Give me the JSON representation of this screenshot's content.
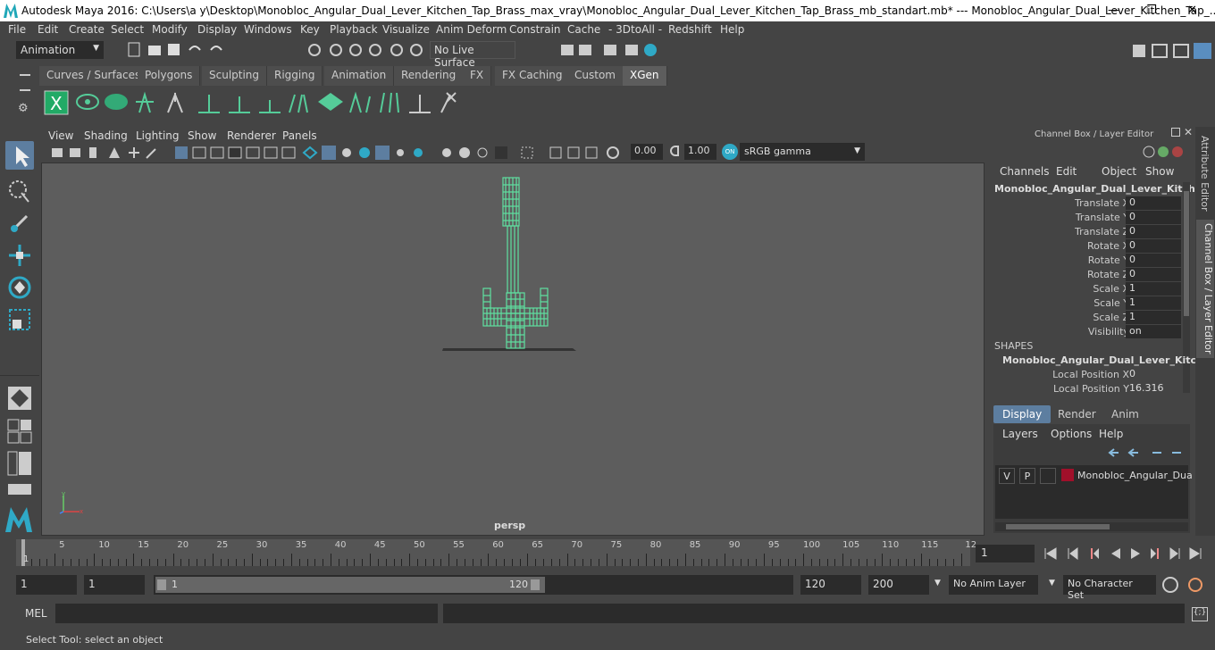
{
  "titlebar": {
    "title": "Autodesk Maya 2016: C:\\Users\\a y\\Desktop\\Monobloc_Angular_Dual_Lever_Kitchen_Tap_Brass_max_vray\\Monobloc_Angular_Dual_Lever_Kitchen_Tap_Brass_mb_standart.mb*  ---  Monobloc_Angular_Dual_Lever_Kitchen_Tap_...",
    "minimize": "—",
    "maximize": "❐",
    "close": "✕"
  },
  "menubar": [
    "File",
    "Edit",
    "Create",
    "Select",
    "Modify",
    "Display",
    "Windows",
    "Key",
    "Playback",
    "Visualize",
    "Anim Deform",
    "Constrain",
    "Cache",
    "- 3DtoAll -",
    "Redshift",
    "Help"
  ],
  "statusline": {
    "menuset": "Animation",
    "live_surface": "No Live Surface"
  },
  "shelf_tabs": [
    "Curves / Surfaces",
    "Polygons",
    "Sculpting",
    "Rigging",
    "Animation",
    "Rendering",
    "FX",
    "FX Caching",
    "Custom",
    "XGen"
  ],
  "active_shelf": "XGen",
  "viewport": {
    "menus": [
      "View",
      "Shading",
      "Lighting",
      "Show",
      "Renderer",
      "Panels"
    ],
    "exposure": "0.00",
    "gamma": "1.00",
    "colorspace": "sRGB gamma",
    "camera_label": "persp"
  },
  "channel_box": {
    "title": "Channel Box / Layer Editor",
    "menus": [
      "Channels",
      "Edit",
      "Object",
      "Show"
    ],
    "object_name": "Monobloc_Angular_Dual_Lever_Kitch...",
    "attributes": [
      {
        "label": "Translate X",
        "value": "0"
      },
      {
        "label": "Translate Y",
        "value": "0"
      },
      {
        "label": "Translate Z",
        "value": "0"
      },
      {
        "label": "Rotate X",
        "value": "0"
      },
      {
        "label": "Rotate Y",
        "value": "0"
      },
      {
        "label": "Rotate Z",
        "value": "0"
      },
      {
        "label": "Scale X",
        "value": "1"
      },
      {
        "label": "Scale Y",
        "value": "1"
      },
      {
        "label": "Scale Z",
        "value": "1"
      },
      {
        "label": "Visibility",
        "value": "on"
      }
    ],
    "shapes_header": "SHAPES",
    "shape_name": "Monobloc_Angular_Dual_Lever_Kitc...",
    "shape_attributes": [
      {
        "label": "Local Position X",
        "value": "0"
      },
      {
        "label": "Local Position Y",
        "value": "16.316"
      }
    ]
  },
  "layer_editor": {
    "tabs": [
      "Display",
      "Render",
      "Anim"
    ],
    "menus": [
      "Layers",
      "Options",
      "Help"
    ],
    "layer": {
      "v": "V",
      "p": "P",
      "name": "Monobloc_Angular_Dua",
      "color": "#a0102a"
    }
  },
  "side_tabs": [
    "Attribute Editor",
    "Channel Box / Layer Editor"
  ],
  "timeline": {
    "ticks": [
      "5",
      "10",
      "15",
      "20",
      "25",
      "30",
      "35",
      "40",
      "45",
      "50",
      "55",
      "60",
      "65",
      "70",
      "75",
      "80",
      "85",
      "90",
      "95",
      "100",
      "105",
      "110",
      "115",
      "12"
    ],
    "start_label": "1",
    "current_frame": "1"
  },
  "range": {
    "start": "1",
    "playback_start": "1",
    "slider_start": "1",
    "slider_end": "120",
    "playback_end": "120",
    "end": "200",
    "anim_layer": "No Anim Layer",
    "character_set": "No Character Set"
  },
  "mel": {
    "label": "MEL"
  },
  "helpline": {
    "text": "Select Tool: select an object"
  },
  "colors": {
    "wireframe": "#5fe0a0",
    "bg": "#444444",
    "viewport": "#5d5d5d"
  }
}
